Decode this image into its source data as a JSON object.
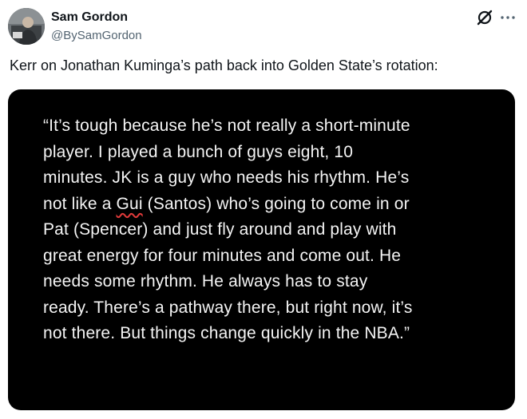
{
  "author": {
    "name": "Sam Gordon",
    "handle": "@BySamGordon",
    "avatar_icon": "profile-photo"
  },
  "header_icons": {
    "grok": "grok-icon",
    "more": "more-icon"
  },
  "tweet": {
    "text": "Kerr on Jonathan Kuminga’s path back into Golden State’s rotation:"
  },
  "media": {
    "background": "#000000",
    "text_color": "#f4f4f4",
    "lines": [
      "“It’s tough because he’s not really a short-minute",
      "player. I played a bunch of guys eight, 10",
      "minutes. JK is a guy who needs his rhythm. He’s",
      "not like a ",
      "Gui",
      " (Santos) who’s going to come in or",
      "Pat (Spencer) and just fly around and play with",
      "great energy for four minutes and come out. He",
      "needs some rhythm. He always has to stay",
      "ready. There’s a pathway there, but right now, it’s",
      "not there. But things change quickly in the NBA.”"
    ]
  },
  "colors": {
    "text_primary": "#0f1419",
    "text_secondary": "#536471",
    "spellcheck_underline": "#e03a3a"
  }
}
